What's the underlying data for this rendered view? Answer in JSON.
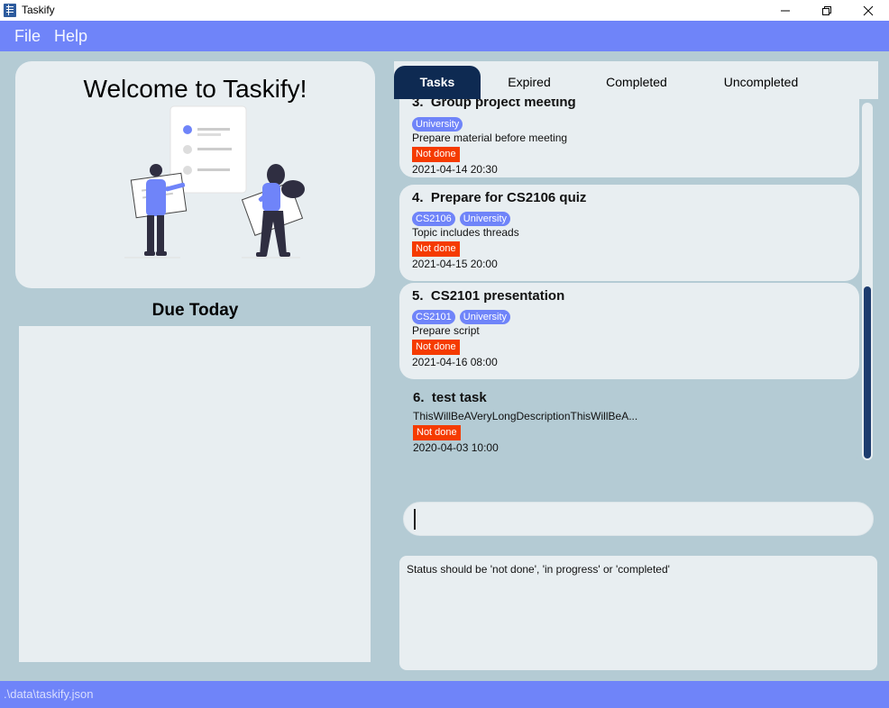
{
  "window": {
    "title": "Taskify",
    "icon": "taskify-app-icon"
  },
  "menu": {
    "file": "File",
    "help": "Help"
  },
  "welcome": {
    "title": "Welcome to Taskify!"
  },
  "due_today": {
    "title": "Due Today"
  },
  "tabs": [
    {
      "label": "Tasks",
      "active": true
    },
    {
      "label": "Expired",
      "active": false
    },
    {
      "label": "Completed",
      "active": false
    },
    {
      "label": "Uncompleted",
      "active": false
    }
  ],
  "tasks": [
    {
      "index": "3.",
      "title": "Group project meeting",
      "tags": [
        "University"
      ],
      "description": "Prepare material before meeting",
      "status": "Not done",
      "datetime": "2021-04-14 20:30"
    },
    {
      "index": "4.",
      "title": "Prepare for CS2106 quiz",
      "tags": [
        "CS2106",
        "University"
      ],
      "description": "Topic includes threads",
      "status": "Not done",
      "datetime": "2021-04-15 20:00"
    },
    {
      "index": "5.",
      "title": "CS2101 presentation",
      "tags": [
        "CS2101",
        "University"
      ],
      "description": "Prepare script",
      "status": "Not done",
      "datetime": "2021-04-16 08:00"
    },
    {
      "index": "6.",
      "title": "test task",
      "tags": [],
      "description": "ThisWillBeAVeryLongDescriptionThisWillBeA...",
      "status": "Not done",
      "datetime": "2020-04-03 10:00"
    }
  ],
  "command": {
    "value": ""
  },
  "result": {
    "message": "Status should be 'not done', 'in progress' or 'completed'"
  },
  "statusbar": {
    "path": ".\\data\\taskify.json"
  },
  "colors": {
    "accent": "#6f84f9",
    "active_tab": "#0e2a52",
    "status_not_done": "#f53b00",
    "panel": "#e8eef1",
    "background": "#b4cbd4"
  }
}
